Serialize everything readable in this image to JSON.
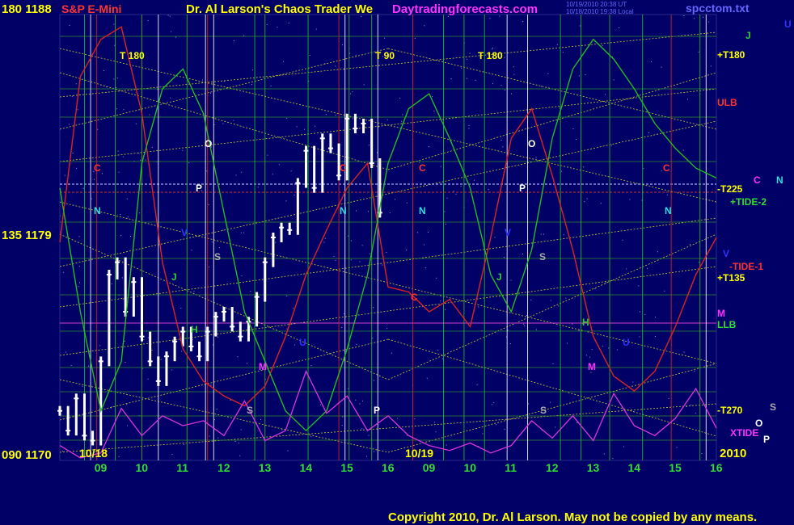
{
  "header": {
    "scale_left": "180 1188",
    "instrument": "S&P E-Mini",
    "site_title": "Dr. Al Larson's Chaos Trader We",
    "site_url": "Daytradingforecasts.com",
    "stamp_1": "10/19/2010 20:38 UT",
    "stamp_2": "10/18/2010 19:38 Local",
    "file": "spcctom.txt",
    "right_corner": "U"
  },
  "colors": {
    "background": "#000066",
    "grid": "#33aa33",
    "scale": "#ffff00",
    "instrument": "#ff3333",
    "url": "#ff33ff",
    "file": "#6666ff",
    "tide_red": "#dd2222",
    "tide_green": "#22bb22",
    "tide_blue": "#1133ff",
    "xtide": "#dd33dd",
    "bars": "#ffffff"
  },
  "footer": {
    "copyright": "Copyright 2010, Dr. Al Larson. May not be copied by any means."
  },
  "chart_data": {
    "type": "line",
    "title": "S&P E-Mini",
    "y_ticks": [
      {
        "label": "135 1179",
        "value": 1179
      },
      {
        "label": "090 1170",
        "value": 1170
      }
    ],
    "ylim": [
      1170,
      1188
    ],
    "dates": [
      "10/18",
      "10/19"
    ],
    "year": "2010",
    "hour_ticks": [
      "09",
      "10",
      "11",
      "12",
      "13",
      "14",
      "15",
      "16",
      "09",
      "10",
      "11",
      "12",
      "13",
      "14",
      "15",
      "16"
    ],
    "t_markers": [
      "T 180",
      "T 90",
      "T 180"
    ],
    "right_labels": [
      {
        "text": "J",
        "color": "#33cc33"
      },
      {
        "text": "+T180",
        "color": "#ffff00"
      },
      {
        "text": "ULB",
        "color": "#ff3333"
      },
      {
        "text": "C",
        "color": "#ff33ff"
      },
      {
        "text": "N",
        "color": "#33dddd"
      },
      {
        "text": "-T225",
        "color": "#ffff00"
      },
      {
        "text": "+TIDE-2",
        "color": "#33dd33"
      },
      {
        "text": "V",
        "color": "#3333ff"
      },
      {
        "text": "-TIDE-1",
        "color": "#ff3333"
      },
      {
        "text": "+T135",
        "color": "#ffff00"
      },
      {
        "text": "M",
        "color": "#ff33ff"
      },
      {
        "text": "LLB",
        "color": "#33dd33"
      },
      {
        "text": "S",
        "color": "#aaaaaa"
      },
      {
        "text": "-T270",
        "color": "#ffff00"
      },
      {
        "text": "O",
        "color": "#ffffff"
      },
      {
        "text": "XTIDE",
        "color": "#ff33ff"
      },
      {
        "text": "P",
        "color": "#ffffff"
      }
    ],
    "planet_glyphs": [
      {
        "text": "C",
        "color": "#ff3333"
      },
      {
        "text": "N",
        "color": "#33dddd"
      },
      {
        "text": "O",
        "color": "#ffffff"
      },
      {
        "text": "P",
        "color": "#ffffff"
      },
      {
        "text": "S",
        "color": "#aaaaaa"
      },
      {
        "text": "V",
        "color": "#3333ff"
      },
      {
        "text": "J",
        "color": "#33cc33"
      },
      {
        "text": "M",
        "color": "#ff33ff"
      },
      {
        "text": "H",
        "color": "#33cc33"
      },
      {
        "text": "U",
        "color": "#3333ff"
      }
    ],
    "series": [
      {
        "name": "S&P E-Mini",
        "style": "price",
        "color": "#ffffff",
        "x": [
          0,
          0.2,
          0.4,
          0.6,
          0.8,
          1.0,
          1.2,
          1.4,
          1.6,
          1.8,
          2.0,
          2.2,
          2.4,
          2.6,
          2.8,
          3.0,
          3.2,
          3.4,
          3.6,
          3.8,
          4.0,
          4.2,
          4.4,
          4.6,
          4.8,
          5.0,
          5.2,
          5.4,
          5.6,
          5.8,
          6.0,
          6.2,
          6.4,
          6.6,
          6.8,
          7.0,
          7.2,
          7.4,
          7.6,
          7.8
        ],
        "y": [
          1172.0,
          1171.2,
          1172.5,
          1171.0,
          1170.8,
          1174.0,
          1177.5,
          1178.0,
          1176.0,
          1177.2,
          1175.0,
          1174.0,
          1173.2,
          1174.2,
          1174.8,
          1175.2,
          1174.6,
          1174.2,
          1175.2,
          1175.8,
          1176.0,
          1175.4,
          1175.0,
          1175.6,
          1176.6,
          1178.0,
          1179.0,
          1179.4,
          1179.3,
          1181.2,
          1182.5,
          1181.0,
          1183.0,
          1182.6,
          1181.5,
          1183.8,
          1183.4,
          1183.6,
          1182.0,
          1180.0
        ]
      },
      {
        "name": "TIDE-1",
        "style": "tide",
        "color": "#dd2222",
        "x": [
          0,
          0.5,
          1.0,
          1.5,
          2.0,
          2.5,
          3.0,
          3.5,
          4.0,
          4.5,
          5.0,
          5.5,
          6.0,
          6.5,
          7.0,
          7.5,
          8.0,
          8.5,
          9.0,
          9.5,
          10.0,
          10.5,
          11.0,
          11.5,
          12.0,
          12.5,
          13.0,
          13.5,
          14.0,
          14.5,
          15.0,
          15.5,
          16.0
        ],
        "y": [
          1178.8,
          1185.5,
          1187.0,
          1187.5,
          1184.0,
          1178.0,
          1174.5,
          1173.2,
          1172.6,
          1172.2,
          1173.0,
          1175.0,
          1177.5,
          1179.3,
          1181.0,
          1182.0,
          1177.0,
          1176.8,
          1176.0,
          1176.5,
          1175.4,
          1179.0,
          1183.0,
          1184.2,
          1181.5,
          1178.5,
          1175.0,
          1173.4,
          1172.8,
          1173.6,
          1175.4,
          1177.5,
          1179.0
        ]
      },
      {
        "name": "TIDE-2",
        "style": "tide",
        "color": "#22bb22",
        "x": [
          0,
          0.5,
          1.0,
          1.5,
          2.0,
          2.5,
          3.0,
          3.5,
          4.0,
          4.5,
          5.0,
          5.5,
          6.0,
          6.5,
          7.0,
          7.5,
          8.0,
          8.5,
          9.0,
          9.5,
          10.0,
          10.5,
          11.0,
          11.5,
          12.0,
          12.5,
          13.0,
          13.5,
          14.0,
          14.5,
          15.0,
          15.5,
          16.0
        ],
        "y": [
          1181.0,
          1176.0,
          1172.0,
          1174.0,
          1182.0,
          1185.0,
          1185.8,
          1184.0,
          1180.0,
          1176.0,
          1174.0,
          1172.0,
          1171.2,
          1172.0,
          1174.5,
          1177.5,
          1182.0,
          1184.2,
          1184.8,
          1183.0,
          1181.0,
          1177.5,
          1176.0,
          1178.5,
          1183.0,
          1185.8,
          1187.0,
          1186.2,
          1185.0,
          1183.6,
          1182.6,
          1181.8,
          1181.4
        ]
      },
      {
        "name": "XTIDE",
        "style": "xtide",
        "color": "#dd33dd",
        "x": [
          0,
          0.5,
          1.0,
          1.5,
          2.0,
          2.5,
          3.0,
          3.5,
          4.0,
          4.5,
          5.0,
          5.5,
          6.0,
          6.5,
          7.0,
          7.5,
          8.0,
          8.5,
          9.0,
          9.5,
          10.0,
          10.5,
          11.0,
          11.5,
          12.0,
          12.5,
          13.0,
          13.5,
          14.0,
          14.5,
          15.0,
          15.5,
          16.0
        ],
        "y": [
          1170.6,
          1170.1,
          1170.3,
          1172.1,
          1171.0,
          1171.8,
          1171.4,
          1171.6,
          1171.0,
          1172.4,
          1170.8,
          1171.2,
          1173.6,
          1171.9,
          1172.6,
          1171.2,
          1171.8,
          1171.0,
          1170.6,
          1170.4,
          1170.7,
          1170.3,
          1170.6,
          1171.6,
          1170.9,
          1171.8,
          1170.8,
          1172.7,
          1171.4,
          1171.0,
          1171.7,
          1172.9,
          1171.3
        ]
      }
    ]
  }
}
